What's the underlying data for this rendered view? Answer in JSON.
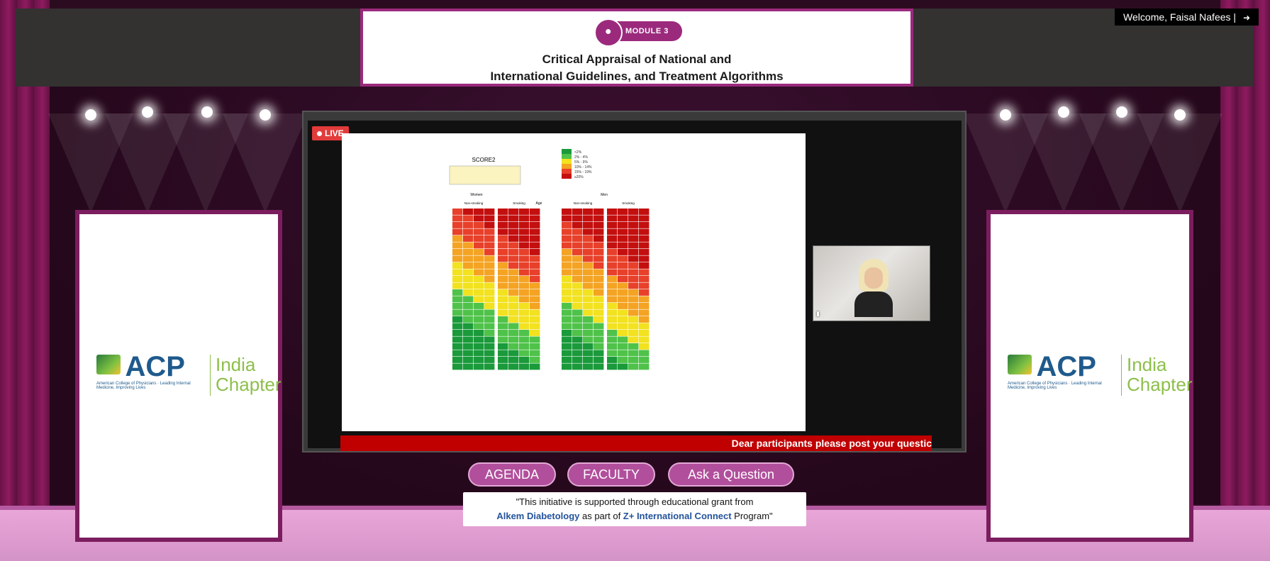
{
  "header": {
    "module_label": "MODULE 3",
    "title_line1": "Critical Appraisal of National and",
    "title_line2": "International Guidelines, and Treatment Algorithms",
    "welcome": "Welcome, Faisal Nafees |"
  },
  "stream": {
    "live_label": "LIVE",
    "ticker": "Dear participants please post your questic"
  },
  "slide": {
    "title": "SCORE2",
    "legend": [
      "<2%",
      "2% - 4%",
      "5% - 9%",
      "10% - 14%",
      "15% - 19%",
      "≥20%"
    ],
    "colors": [
      "#1a9a3a",
      "#4fc24a",
      "#f2e21f",
      "#f4a323",
      "#e8402a",
      "#c40f0f"
    ],
    "group_women": "Women",
    "group_men": "Men",
    "sub_nonsmoking": "Non-smoking",
    "sub_smoking": "Smoking",
    "age_label": "Age"
  },
  "banners": {
    "acp_word": "ACP",
    "acp_sub": "American College of Physicians · Leading Internal Medicine, Improving Lives",
    "chapter_line1": "India",
    "chapter_line2": "Chapter"
  },
  "nav": {
    "agenda": "AGENDA",
    "faculty": "FACULTY",
    "ask": "Ask a Question"
  },
  "grant": {
    "line1": "\"This initiative is supported through educational grant from",
    "sponsor": "Alkem Diabetology",
    "middle": " as part of ",
    "program": "Z+ International Connect",
    "end": " Program\""
  }
}
